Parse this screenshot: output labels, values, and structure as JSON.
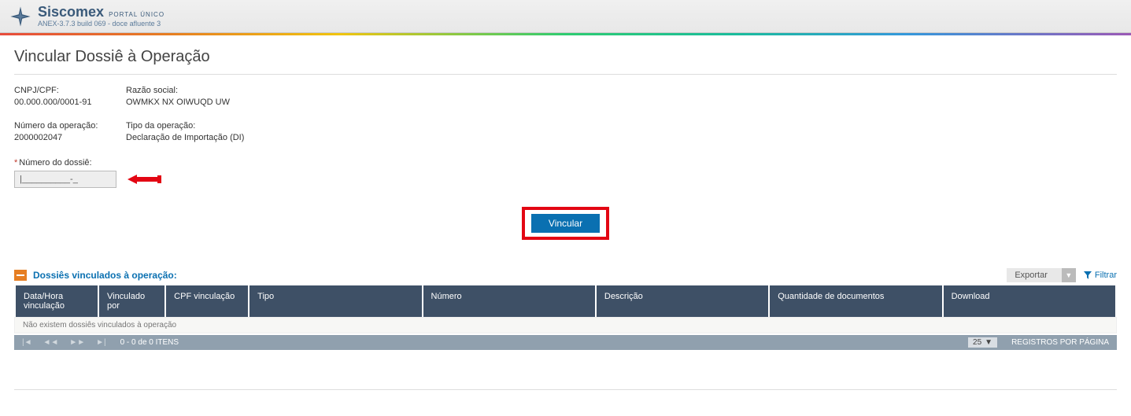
{
  "header": {
    "portal": "PORTAL ÚNICO",
    "siscomex": "Siscomex",
    "build": "ANEX-3.7.3 build 069 - doce afluente 3"
  },
  "page": {
    "title": "Vincular Dossiê à Operação"
  },
  "info": {
    "cnpj_label": "CNPJ/CPF:",
    "cnpj_value": "00.000.000/0001-91",
    "razao_label": "Razão social:",
    "razao_value": "OWMKX NX OIWUQD UW",
    "numop_label": "Número da operação:",
    "numop_value": "2000002047",
    "tipoop_label": "Tipo da operação:",
    "tipoop_value": "Declaração de Importação (DI)"
  },
  "dossie": {
    "label": "Número do dossiê:",
    "input_value": "|__________-_"
  },
  "buttons": {
    "vincular": "Vincular"
  },
  "section": {
    "title": "Dossiês vinculados à operação:",
    "export": "Exportar",
    "filtrar": "Filtrar"
  },
  "table": {
    "columns": {
      "data_vinc": "Data/Hora vinculação",
      "vinc_por": "Vinculado por",
      "cpf_vinc": "CPF vinculação",
      "tipo": "Tipo",
      "numero": "Número",
      "descricao": "Descrição",
      "qtd_doc": "Quantidade de documentos",
      "download": "Download"
    },
    "empty_message": "Não existem dossiês vinculados à operação"
  },
  "pager": {
    "summary": "0 - 0 de 0 ITENS",
    "page_size": "25",
    "per_page_label": "REGISTROS POR PÁGINA"
  }
}
